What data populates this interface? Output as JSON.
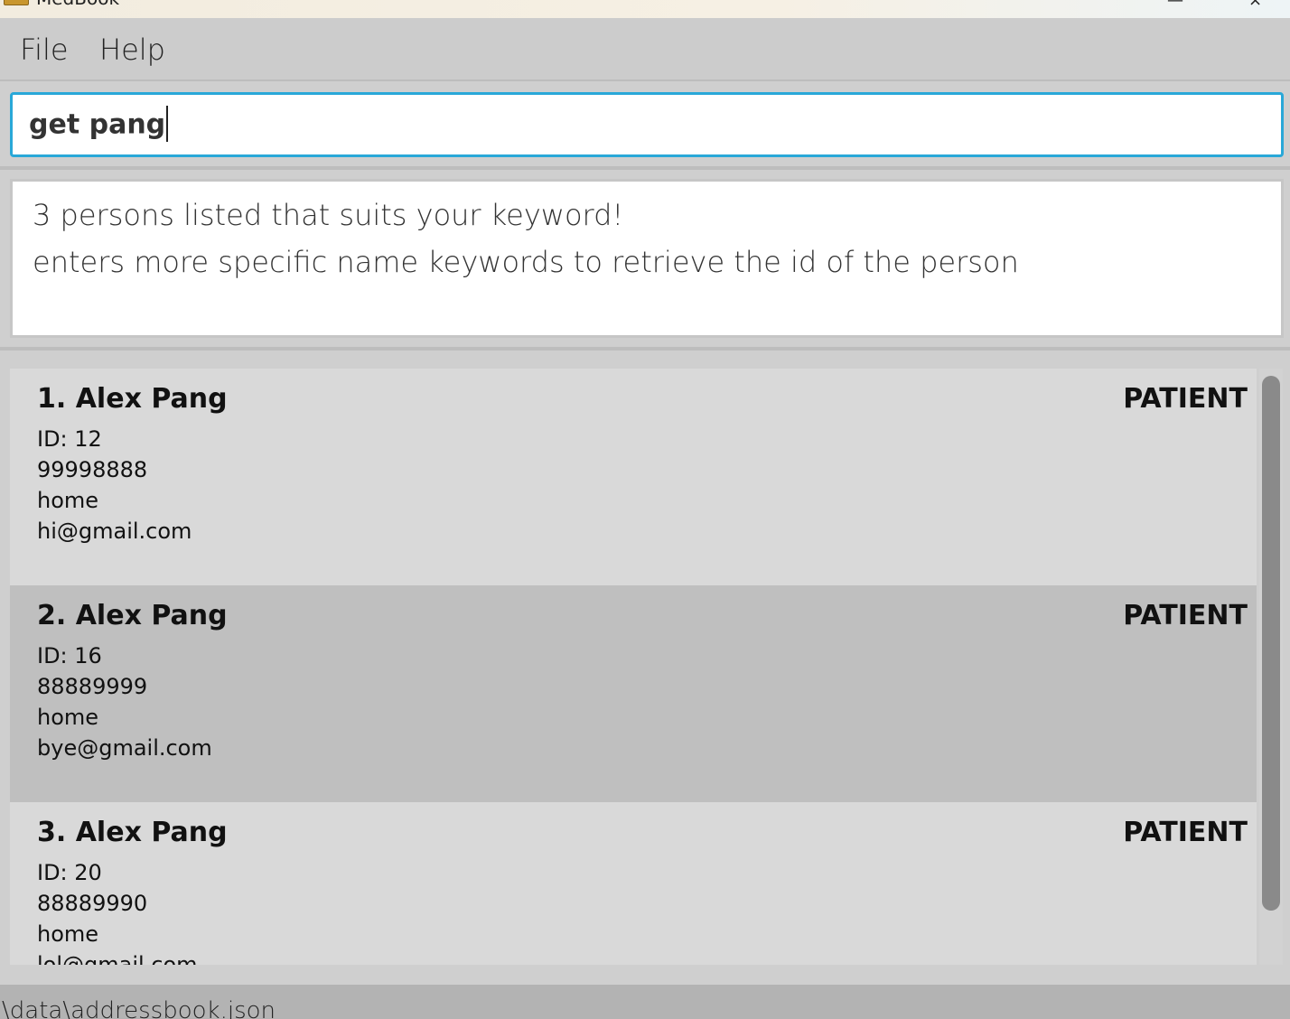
{
  "window": {
    "title": "MedBook",
    "minimize_glyph": "—",
    "close_glyph": "×"
  },
  "menu": {
    "file": "File",
    "help": "Help"
  },
  "command": {
    "value": "get pang"
  },
  "result": {
    "line1": "3 persons listed that suits your keyword!",
    "line2": "enters more specific name keywords to retrieve the id of the person"
  },
  "persons": [
    {
      "name": "1. Alex Pang",
      "role": "PATIENT",
      "id": "ID: 12",
      "phone": "99998888",
      "address": "home",
      "email": "hi@gmail.com",
      "selected": false
    },
    {
      "name": "2. Alex Pang",
      "role": "PATIENT",
      "id": "ID: 16",
      "phone": "88889999",
      "address": "home",
      "email": "bye@gmail.com",
      "selected": true
    },
    {
      "name": "3. Alex Pang",
      "role": "PATIENT",
      "id": "ID: 20",
      "phone": "88889990",
      "address": "home",
      "email": "lol@gmail.com",
      "selected": false
    }
  ],
  "status": {
    "path": "\\data\\addressbook.json"
  },
  "colors": {
    "card_bg": "#d9d9d9",
    "card_selected_bg": "#bfbfbf",
    "command_border": "#29a8d8"
  }
}
